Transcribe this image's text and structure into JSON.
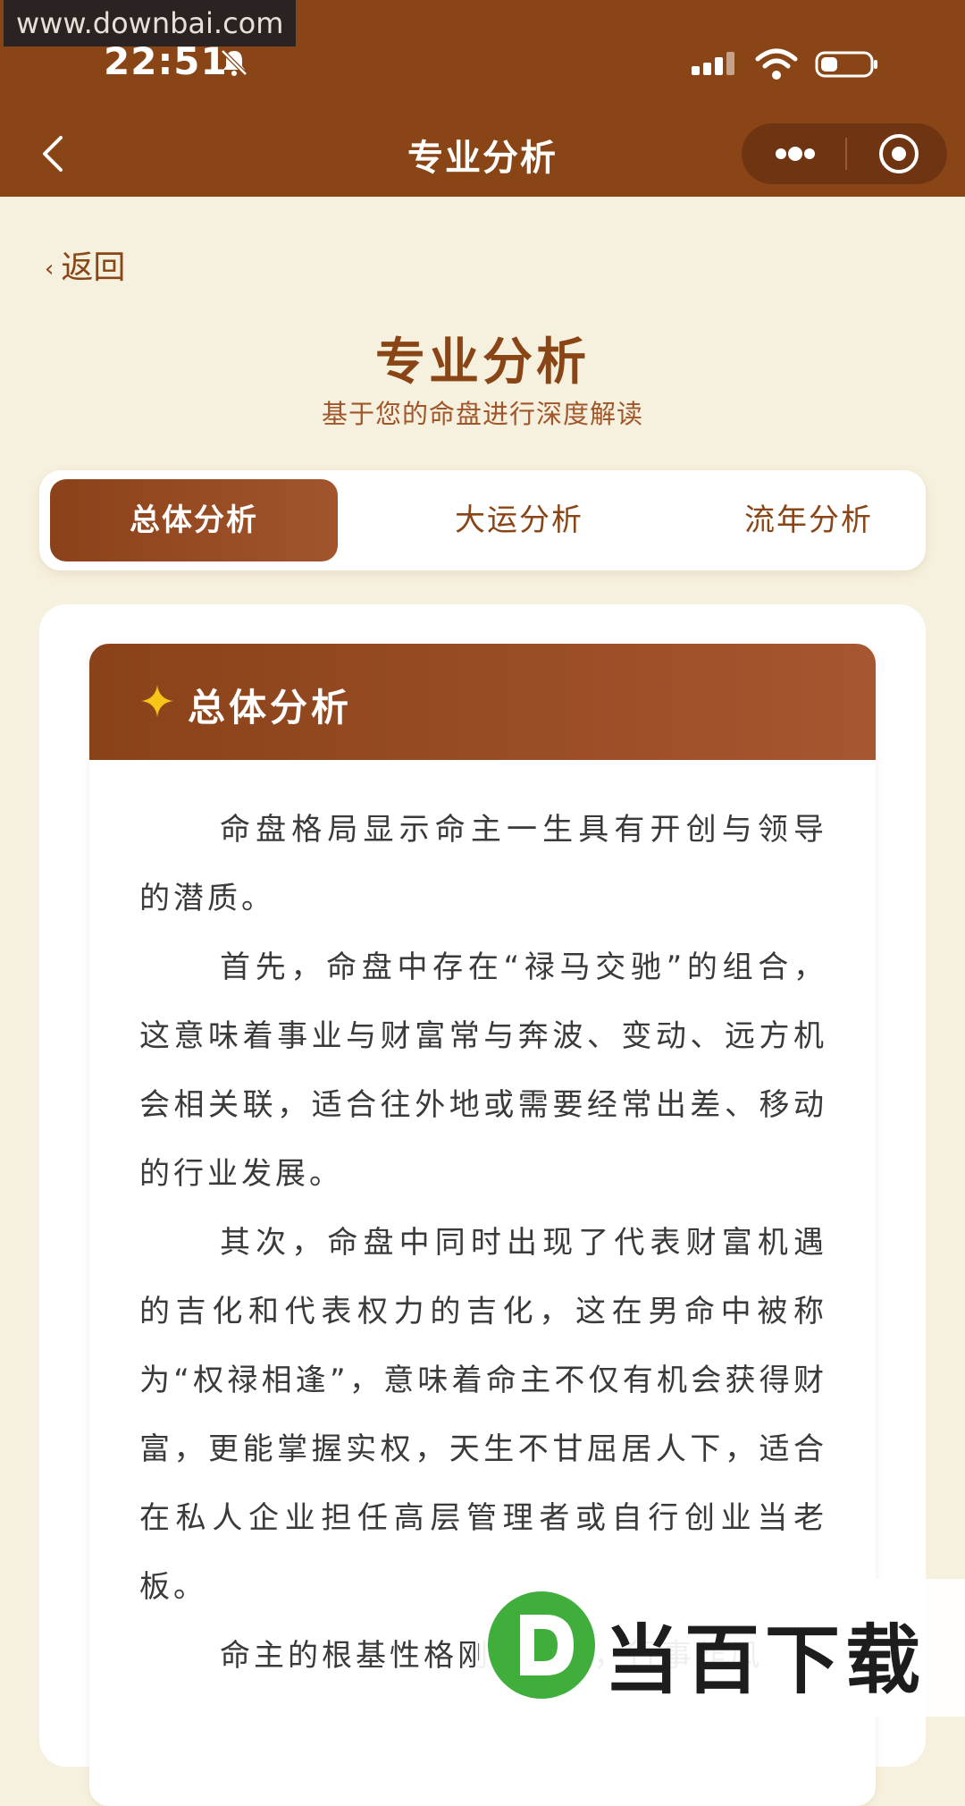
{
  "watermark": {
    "site": "www.downbai.com",
    "logo_text": "当百下载"
  },
  "status_bar": {
    "time": "22:51"
  },
  "nav": {
    "title": "专业分析"
  },
  "page": {
    "back_label": "返回",
    "title": "专业分析",
    "subtitle": "基于您的命盘进行深度解读"
  },
  "tabs": [
    {
      "label": "总体分析",
      "active": true
    },
    {
      "label": "大运分析",
      "active": false
    },
    {
      "label": "流年分析",
      "active": false
    }
  ],
  "section": {
    "title": "总体分析",
    "paragraphs": [
      "命盘格局显示命主一生具有开创与领导的潜质。",
      "首先，命盘中存在“禄马交驰”的组合，这意味着事业与财富常与奔波、变动、远方机会相关联，适合往外地或需要经常出差、移动的行业发展。",
      "其次，命盘中同时出现了代表财富机遇的吉化和代表权力的吉化，这在男命中被称为“权禄相逢”，意味着命主不仅有机会获得财富，更能掌握实权，天生不甘屈居人下，适合在私人企业担任高层管理者或自行创业当老板。",
      "命主的根基性格刚毅果决，行事作风"
    ]
  },
  "colors": {
    "brand": "#8a4517",
    "background": "#f6f1de",
    "star": "#f5c518"
  },
  "icons": [
    "back-arrow-icon",
    "bell-mute-icon",
    "signal-icon",
    "wifi-icon",
    "battery-icon",
    "more-icon",
    "target-icon",
    "star-icon"
  ]
}
